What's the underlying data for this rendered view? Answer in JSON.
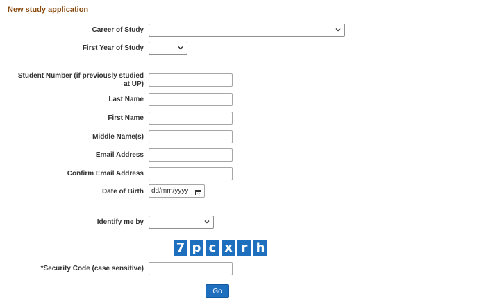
{
  "section": {
    "title": "New study application"
  },
  "fields": {
    "career_of_study": {
      "label": "Career of Study",
      "value": ""
    },
    "first_year_of_study": {
      "label": "First Year of Study",
      "value": ""
    },
    "student_number": {
      "label": "Student Number (if previously studied at UP)",
      "value": ""
    },
    "last_name": {
      "label": "Last Name",
      "value": ""
    },
    "first_name": {
      "label": "First Name",
      "value": ""
    },
    "middle_names": {
      "label": "Middle Name(s)",
      "value": ""
    },
    "email": {
      "label": "Email Address",
      "value": ""
    },
    "confirm_email": {
      "label": "Confirm Email Address",
      "value": ""
    },
    "date_of_birth": {
      "label": "Date of Birth",
      "placeholder": "dd/mm/yyyy"
    },
    "identify_me_by": {
      "label": "Identify me by",
      "value": ""
    },
    "security_code": {
      "label": "*Security Code (case sensitive)",
      "value": ""
    }
  },
  "captcha": {
    "characters": [
      "7",
      "p",
      "c",
      "x",
      "r",
      "h"
    ]
  },
  "buttons": {
    "go": "Go"
  },
  "colors": {
    "heading": "#8a4a0e",
    "accent": "#1f6fbf"
  }
}
